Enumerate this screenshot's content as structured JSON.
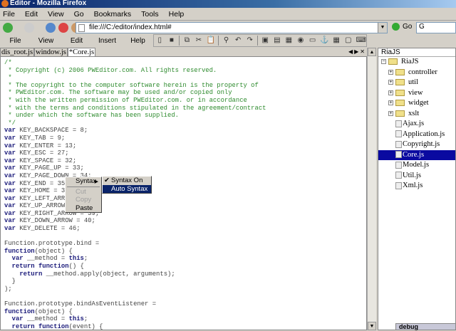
{
  "window": {
    "title": "Editor - Mozilla Firefox"
  },
  "browser_menu": [
    "File",
    "Edit",
    "View",
    "Go",
    "Bookmarks",
    "Tools",
    "Help"
  ],
  "address": {
    "url": "file:///C:/editor/index.html#",
    "go_label": "Go",
    "search_icon": "G"
  },
  "editor_menu": [
    "File",
    "View",
    "Edit",
    "Insert",
    "Help"
  ],
  "toolbar_icons": [
    "new-icon",
    "save-icon",
    "copy-icon",
    "cut-icon",
    "paste-icon",
    "find-icon",
    "undo-icon",
    "redo-icon",
    "image-icon",
    "table-icon",
    "frame-icon",
    "globe-icon",
    "form-icon",
    "anchor-icon",
    "calendar-icon",
    "preview-icon",
    "keyboard-icon"
  ],
  "tabs": [
    {
      "label": "dis_root.js",
      "active": false
    },
    {
      "label": "window.js",
      "active": false
    },
    {
      "label": "*Core.js",
      "active": true
    }
  ],
  "code_lines": [
    [
      [
        "c",
        "/*"
      ]
    ],
    [
      [
        "c",
        " * Copyright (c) 2006 PWEditor.com. All rights reserved."
      ]
    ],
    [
      [
        "c",
        " *"
      ]
    ],
    [
      [
        "c",
        " * The copyright to the computer software herein is the property of"
      ]
    ],
    [
      [
        "c",
        " * PWEditor.com. The software may be used and/or copied only"
      ]
    ],
    [
      [
        "c",
        " * with the written permission of PWEditor.com. or in accordance"
      ]
    ],
    [
      [
        "c",
        " * with the terms and conditions stipulated in the agreement/contract"
      ]
    ],
    [
      [
        "c",
        " * under which the software has been supplied."
      ]
    ],
    [
      [
        "c",
        " */"
      ]
    ],
    [
      [
        "k",
        "var"
      ],
      [
        "p",
        " KEY_BACKSPACE = 8;"
      ]
    ],
    [
      [
        "k",
        "var"
      ],
      [
        "p",
        " KEY_TAB = 9;"
      ]
    ],
    [
      [
        "k",
        "var"
      ],
      [
        "p",
        " KEY_ENTER = 13;"
      ]
    ],
    [
      [
        "k",
        "var"
      ],
      [
        "p",
        " KEY_ESC = 27;"
      ]
    ],
    [
      [
        "k",
        "var"
      ],
      [
        "p",
        " KEY_SPACE = 32;"
      ]
    ],
    [
      [
        "k",
        "var"
      ],
      [
        "p",
        " KEY_PAGE_UP = 33;"
      ]
    ],
    [
      [
        "k",
        "var"
      ],
      [
        "p",
        " KEY_PAGE_DOWN = 34;"
      ]
    ],
    [
      [
        "k",
        "var"
      ],
      [
        "p",
        " KEY_END = 35;"
      ]
    ],
    [
      [
        "k",
        "var"
      ],
      [
        "p",
        " KEY_HOME = 36;"
      ]
    ],
    [
      [
        "k",
        "var"
      ],
      [
        "p",
        " KEY_LEFT_ARROW = 37;"
      ]
    ],
    [
      [
        "k",
        "var"
      ],
      [
        "p",
        " KEY_UP_ARROW = 38;"
      ]
    ],
    [
      [
        "k",
        "var"
      ],
      [
        "p",
        " KEY_RIGHT_ARROW = 39;"
      ]
    ],
    [
      [
        "k",
        "var"
      ],
      [
        "p",
        " KEY_DOWN_ARROW = 40;"
      ]
    ],
    [
      [
        "k",
        "var"
      ],
      [
        "p",
        " KEY_DELETE = 46;"
      ]
    ],
    [
      [
        "p",
        ""
      ]
    ],
    [
      [
        "p",
        "Function.prototype.bind ="
      ]
    ],
    [
      [
        "k",
        "function"
      ],
      [
        "p",
        "(object) {"
      ]
    ],
    [
      [
        "p",
        "  "
      ],
      [
        "k",
        "var"
      ],
      [
        "p",
        " __method = "
      ],
      [
        "k",
        "this"
      ],
      [
        "p",
        ";"
      ]
    ],
    [
      [
        "p",
        "  "
      ],
      [
        "k",
        "return"
      ],
      [
        "p",
        " "
      ],
      [
        "k",
        "function"
      ],
      [
        "p",
        "() {"
      ]
    ],
    [
      [
        "p",
        "    "
      ],
      [
        "k",
        "return"
      ],
      [
        "p",
        " __method.apply(object, arguments);"
      ]
    ],
    [
      [
        "p",
        "  }"
      ]
    ],
    [
      [
        "p",
        ");"
      ]
    ],
    [
      [
        "p",
        ""
      ]
    ],
    [
      [
        "p",
        "Function.prototype.bindAsEventListener ="
      ]
    ],
    [
      [
        "k",
        "function"
      ],
      [
        "p",
        "(object) {"
      ]
    ],
    [
      [
        "p",
        "  "
      ],
      [
        "k",
        "var"
      ],
      [
        "p",
        " __method = "
      ],
      [
        "k",
        "this"
      ],
      [
        "p",
        ";"
      ]
    ],
    [
      [
        "p",
        "  "
      ],
      [
        "k",
        "return"
      ],
      [
        "p",
        " "
      ],
      [
        "k",
        "function"
      ],
      [
        "p",
        "(event) {"
      ]
    ]
  ],
  "context_menu": {
    "items": [
      {
        "label": "Syntax",
        "disabled": false
      },
      {
        "label": "Cut",
        "disabled": true
      },
      {
        "label": "Copy",
        "disabled": true
      },
      {
        "label": "Paste",
        "disabled": false
      }
    ],
    "submenu": [
      {
        "label": "Syntax On",
        "checked": true,
        "highlighted": false
      },
      {
        "label": "Auto Syntax",
        "checked": false,
        "highlighted": true
      }
    ]
  },
  "project": {
    "header": "RiaJS",
    "root": "RiaJS",
    "folders": [
      "controller",
      "util",
      "view",
      "widget",
      "xslt"
    ],
    "files": [
      "Ajax.js",
      "Application.js",
      "Copyright.js",
      "Core.js",
      "Model.js",
      "Util.js",
      "Xml.js"
    ],
    "selected": "Core.js"
  },
  "bottom_tab": "debug",
  "colors": {
    "accent": "#0a0aa0",
    "comment": "#2e8b2e",
    "keyword": "#1a1a7a"
  }
}
